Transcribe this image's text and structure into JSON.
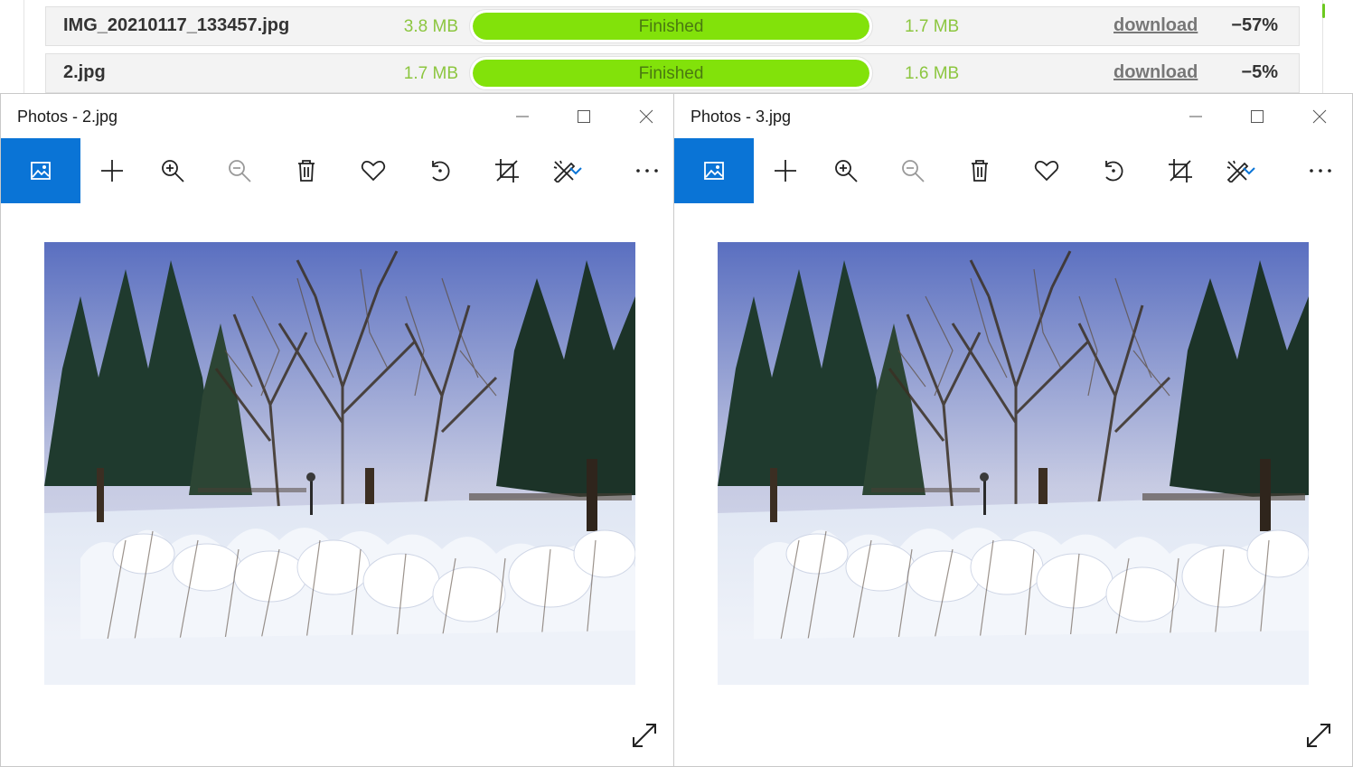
{
  "compressor": {
    "files": [
      {
        "name": "IMG_20210117_133457.jpg",
        "original_size": "3.8 MB",
        "status": "Finished",
        "progress": 1.0,
        "new_size": "1.7 MB",
        "link": "download",
        "saving": "−57%"
      },
      {
        "name": "2.jpg",
        "original_size": "1.7 MB",
        "status": "Finished",
        "progress": 1.0,
        "new_size": "1.6 MB",
        "link": "download",
        "saving": "−5%"
      }
    ]
  },
  "windows": [
    {
      "title": "Photos - 2.jpg"
    },
    {
      "title": "Photos - 3.jpg"
    }
  ],
  "toolbar": {
    "buttons": [
      "view-photo-icon",
      "add-icon",
      "zoom-in-icon",
      "zoom-out-icon",
      "delete-icon",
      "favorite-icon",
      "rotate-icon",
      "crop-icon",
      "edit-draw-icon",
      "chevron-down-icon",
      "more-icon"
    ]
  },
  "window_controls": [
    "minimize-icon",
    "maximize-icon",
    "close-icon"
  ],
  "colors": {
    "accent": "#0a74d6",
    "progress_fill": "#82e20a",
    "size_text": "#8cc63f"
  }
}
